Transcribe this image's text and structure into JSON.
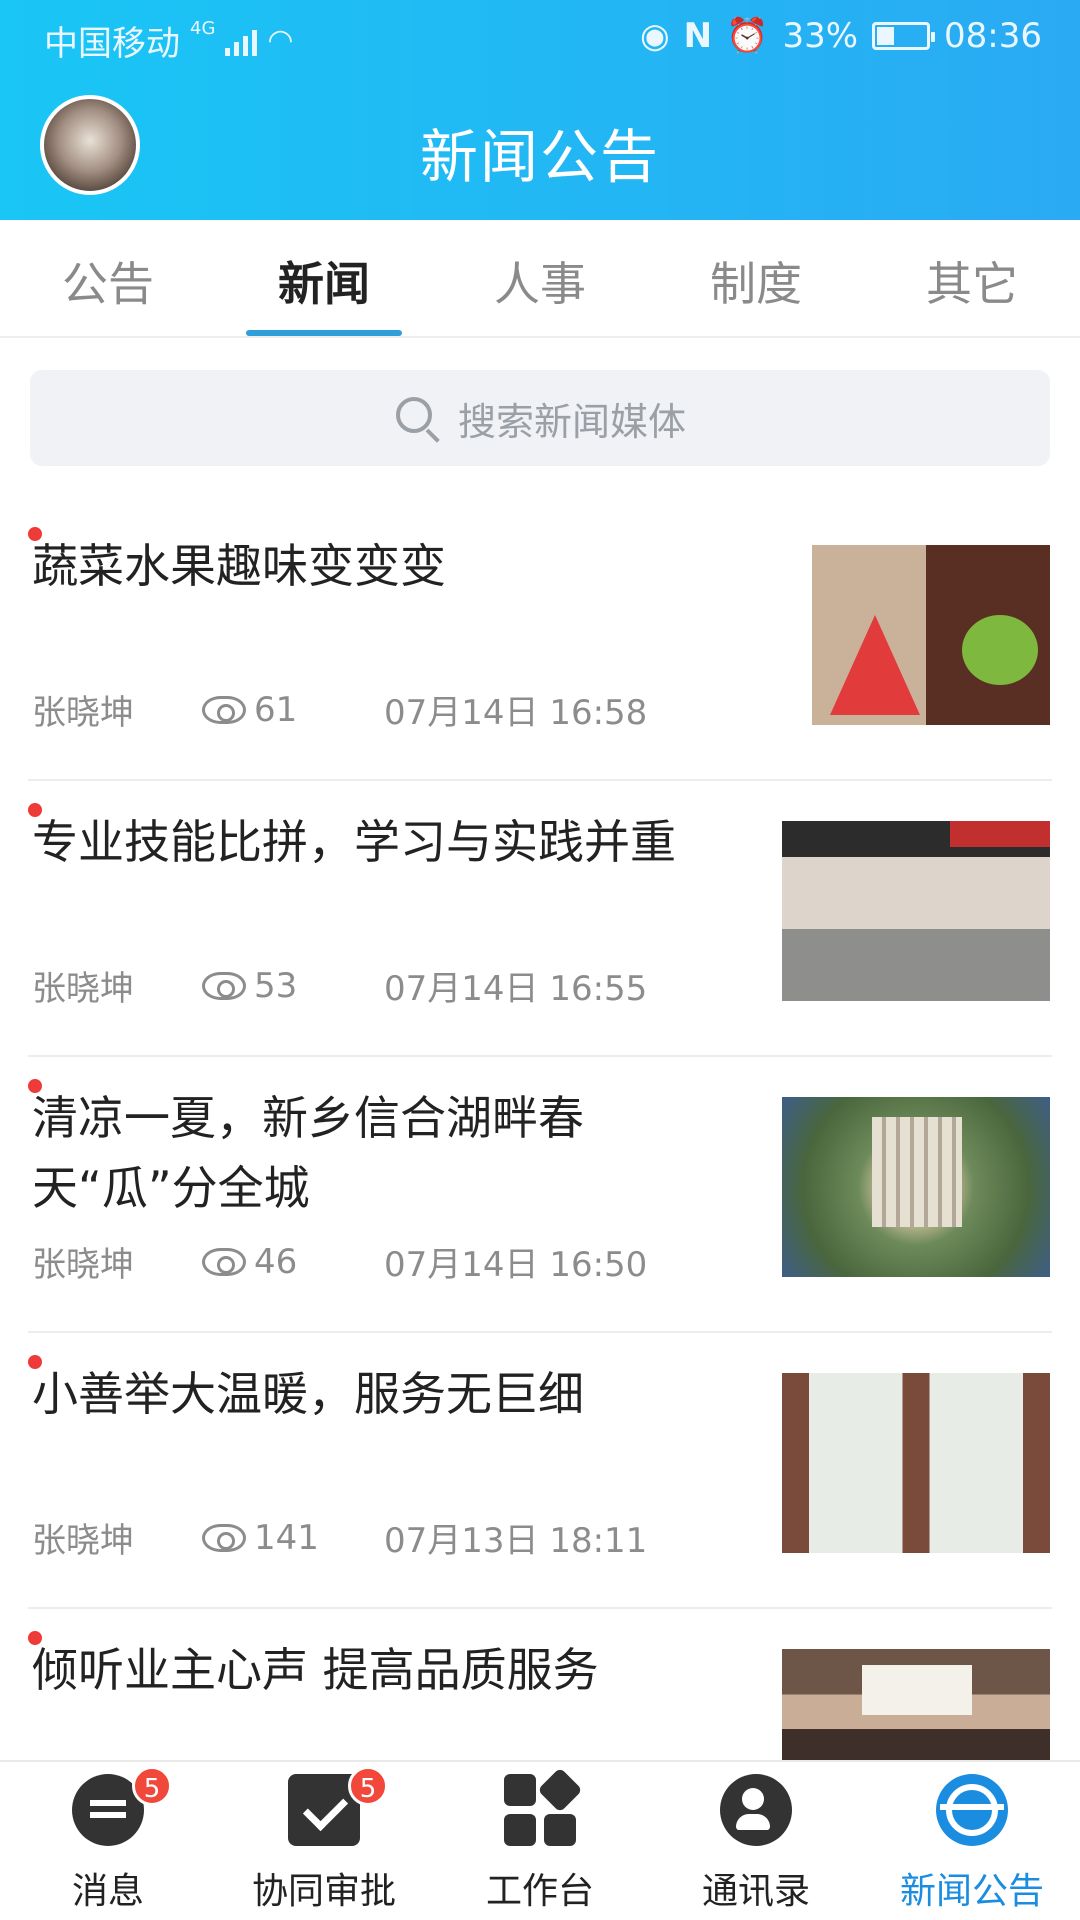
{
  "status_bar": {
    "carrier": "中国移动",
    "network": "4G",
    "battery": "33%",
    "battery_level": 0.33,
    "time": "08:36"
  },
  "header": {
    "title": "新闻公告"
  },
  "tabs": [
    {
      "label": "公告",
      "active": false
    },
    {
      "label": "新闻",
      "active": true
    },
    {
      "label": "人事",
      "active": false
    },
    {
      "label": "制度",
      "active": false
    },
    {
      "label": "其它",
      "active": false
    }
  ],
  "search": {
    "placeholder": "搜索新闻媒体"
  },
  "news": [
    {
      "title": "蔬菜水果趣味变变变",
      "author": "张晓坤",
      "views": "61",
      "time": "07月14日 16:58"
    },
    {
      "title": "专业技能比拼，学习与实践并重",
      "author": "张晓坤",
      "views": "53",
      "time": "07月14日 16:55"
    },
    {
      "title": "清凉一夏，新乡信合湖畔春天“瓜”分全城",
      "author": "张晓坤",
      "views": "46",
      "time": "07月14日 16:50"
    },
    {
      "title": "小善举大温暖，服务无巨细",
      "author": "张晓坤",
      "views": "141",
      "time": "07月13日 18:11"
    },
    {
      "title": "倾听业主心声  提高品质服务",
      "author": "",
      "views": "",
      "time": ""
    }
  ],
  "bottom_nav": [
    {
      "label": "消息",
      "badge": "5",
      "icon": "message-icon"
    },
    {
      "label": "协同审批",
      "badge": "5",
      "icon": "approval-icon"
    },
    {
      "label": "工作台",
      "badge": "",
      "icon": "workbench-icon"
    },
    {
      "label": "通讯录",
      "badge": "",
      "icon": "contacts-icon"
    },
    {
      "label": "新闻公告",
      "badge": "",
      "icon": "news-globe-icon",
      "active": true
    }
  ],
  "colors": {
    "header_gradient_start": "#19c6f5",
    "header_gradient_end": "#2aaaf3",
    "accent": "#1b8de0",
    "unread_dot": "#ef3a3a"
  }
}
